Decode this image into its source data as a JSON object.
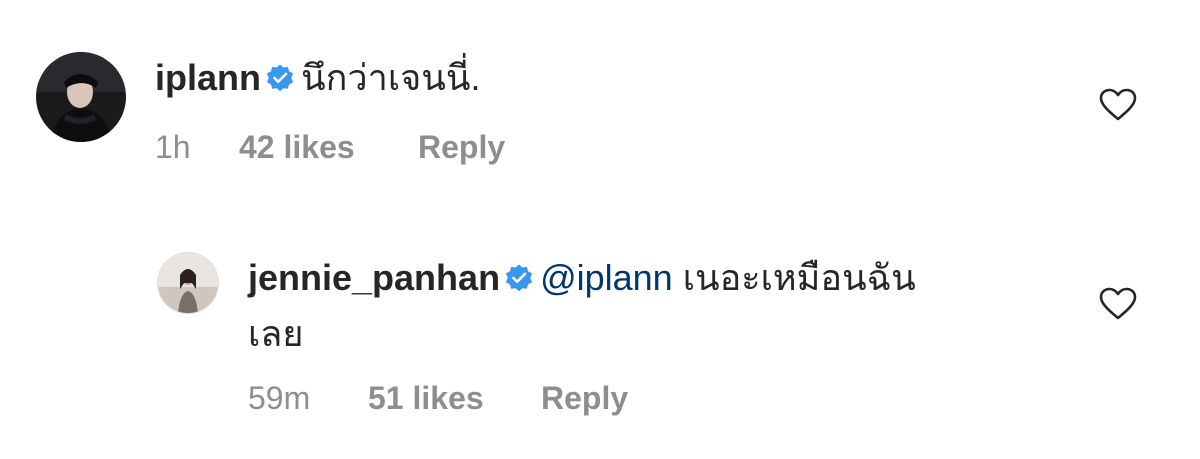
{
  "comments": [
    {
      "username": "iplann",
      "verified": true,
      "text": "นึกว่าเจนนี่.",
      "time": "1h",
      "likes": "42 likes",
      "reply": "Reply",
      "avatar_icon": "profile-photo-dark"
    },
    {
      "username": "jennie_panhan",
      "verified": true,
      "mention": "@iplann",
      "text_line1": "เนอะเหมือนฉัน",
      "text_line2": "เลย",
      "time": "59m",
      "likes": "51 likes",
      "reply": "Reply",
      "avatar_icon": "profile-photo-light"
    }
  ],
  "icons": {
    "verified": "verified-badge-icon",
    "like": "heart-outline-icon"
  },
  "colors": {
    "verified": "#3897f0",
    "mention": "#00376b",
    "meta": "#8e8e8e",
    "text": "#262626"
  }
}
